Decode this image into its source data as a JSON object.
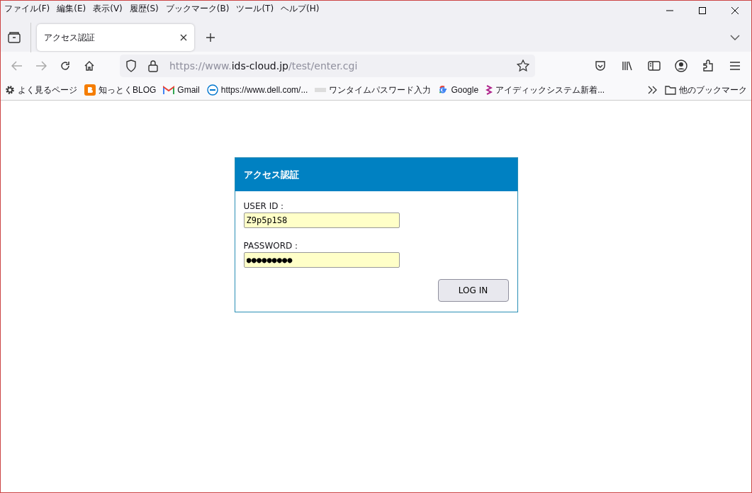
{
  "menu": [
    "ファイル(F)",
    "編集(E)",
    "表示(V)",
    "履歴(S)",
    "ブックマーク(B)",
    "ツール(T)",
    "ヘルプ(H)"
  ],
  "tabs": [
    {
      "label": "アクセス認証",
      "selected": true
    }
  ],
  "address": {
    "prefix": "https://www.",
    "domain": "ids-cloud.jp",
    "path": "/test/enter.cgi"
  },
  "bookmarks": [
    {
      "label": "よく見るページ",
      "kind": "gear"
    },
    {
      "label": "知っとくBLOG",
      "kind": "blog"
    },
    {
      "label": "Gmail",
      "kind": "gmail"
    },
    {
      "label": "https://www.dell.com/...",
      "kind": "dell"
    },
    {
      "label": "ワンタイムパスワード入力",
      "kind": "small"
    },
    {
      "label": "Google",
      "kind": "google"
    },
    {
      "label": "アイディックシステム新着...",
      "kind": "ribbon"
    }
  ],
  "other_bookmarks": "他のブックマーク",
  "login": {
    "title": "アクセス認証",
    "fields": [
      {
        "label": "USER ID：",
        "value": "Z9p5p1S8"
      },
      {
        "label": "PASSWORD：",
        "value": "●●●●●●●●●"
      }
    ],
    "button": "LOG IN"
  }
}
